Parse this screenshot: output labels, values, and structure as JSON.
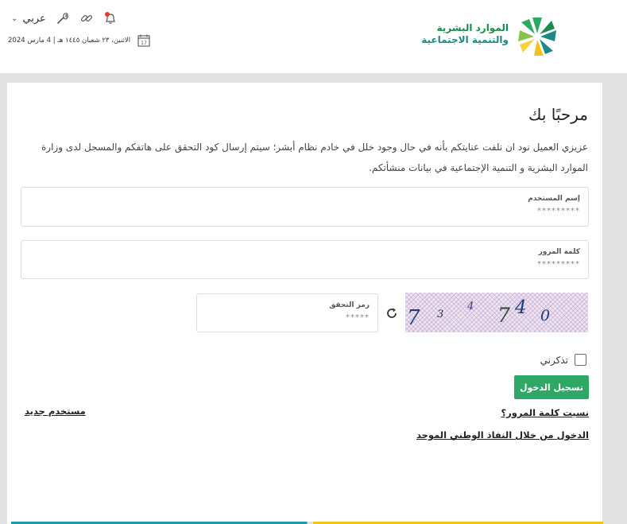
{
  "header": {
    "logo": {
      "line1": "الموارد البشرية",
      "line2": "والتنمية الاجتماعية"
    },
    "language": "عربي",
    "icons": [
      "notification-bell-icon",
      "link-icon",
      "tools-icon",
      "chevron-down-icon"
    ],
    "date": "الاثنين، ٢٣ شعبان ١٤٤٥ هـ | 4 مارس 2024",
    "calendar_day": "17"
  },
  "login": {
    "title": "مرحبًا بك",
    "intro": "عزيزي العميل نود ان نلفت عنايتكم بأنه في حال وجود خلل في خادم نظام أبشر؛ سيتم إرسال كود التحقق على هاتفكم والمسجل لدى وزارة الموارد البشرية و التنمية الإجتماعية في بيانات منشأتكم.",
    "username": {
      "label": "إسم المستخدم",
      "placeholder": "*********",
      "value": ""
    },
    "password": {
      "label": "كلمة المرور",
      "placeholder": "*********",
      "value": ""
    },
    "captcha_field": {
      "label": "رمز التحقق",
      "placeholder": "*****",
      "value": ""
    },
    "captcha_chars": [
      "7",
      "3",
      "4",
      "7",
      "4",
      "0"
    ],
    "remember_label": "تذكرني",
    "remember_checked": false,
    "login_button": "تسجيل الدخول",
    "forgot_password": "نسيت كلمة المرور؟",
    "new_user": "مستخدم جديد",
    "nafath_login": "الدخول من خلال النفاذ الوطني الموحد"
  },
  "colors": {
    "primary_green": "#2fa866",
    "logo_green": "#1c8b4c",
    "background": "#e1e1e1"
  }
}
